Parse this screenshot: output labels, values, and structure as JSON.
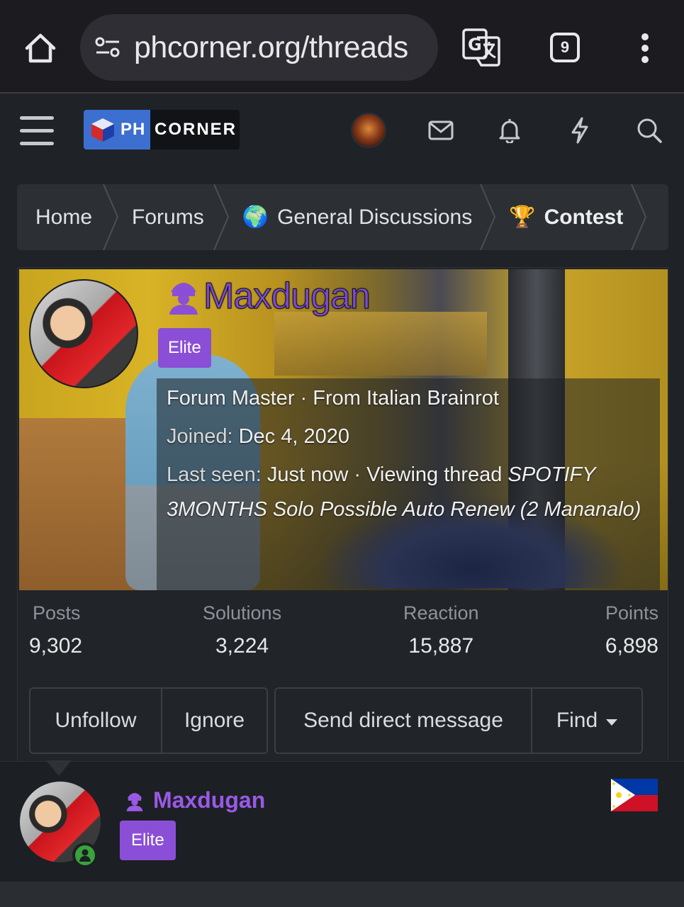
{
  "browser": {
    "url": "phcorner.org/threads",
    "tab_count": "9"
  },
  "header": {
    "logo_ph": "PH",
    "logo_corner": "CORNER"
  },
  "breadcrumb": [
    {
      "label": "Home",
      "emoji": ""
    },
    {
      "label": "Forums",
      "emoji": ""
    },
    {
      "label": "General Discussions",
      "emoji": "🌍"
    },
    {
      "label": "Contest",
      "emoji": "🏆"
    }
  ],
  "profile": {
    "username": "Maxdugan",
    "badge": "Elite",
    "title_line": "Forum Master · From Italian Brainrot",
    "joined_label": "Joined:",
    "joined_value": "Dec 4, 2020",
    "last_seen_label": "Last seen:",
    "last_seen_value": "Just now · Viewing thread",
    "viewing_thread": "SPOTIFY 3MONTHS Solo Possible Auto Renew (2 Mananalo)",
    "stats": [
      {
        "label": "Posts",
        "value": "9,302"
      },
      {
        "label": "Solutions",
        "value": "3,224"
      },
      {
        "label": "Reaction",
        "value": "15,887"
      },
      {
        "label": "Points",
        "value": "6,898"
      }
    ],
    "actions": {
      "unfollow": "Unfollow",
      "ignore": "Ignore",
      "send_dm": "Send direct message",
      "find": "Find"
    }
  },
  "post_author": {
    "username": "Maxdugan",
    "badge": "Elite"
  },
  "colors": {
    "username_purple": "#9a59e6",
    "badge_purple": "#8a4fd6",
    "background": "#1f2226",
    "online_green": "#37a33b"
  }
}
